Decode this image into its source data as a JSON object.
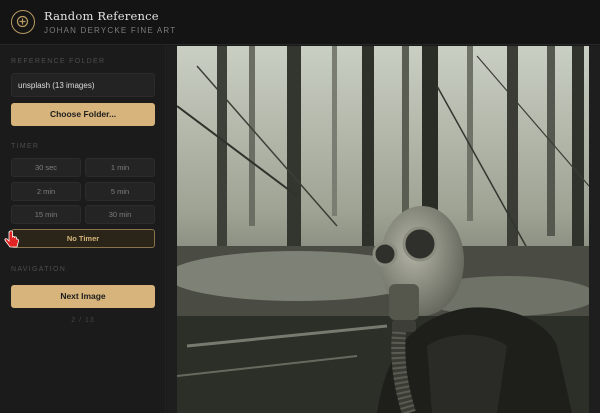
{
  "header": {
    "title": "Random Reference",
    "subtitle": "JOHAN DERYCKE FINE ART",
    "logo_icon": "plus-circle-icon"
  },
  "sidebar": {
    "folder": {
      "label": "REFERENCE FOLDER",
      "value": "unsplash (13 images)",
      "button": "Choose Folder..."
    },
    "timer": {
      "label": "TIMER",
      "options": [
        "30 sec",
        "1 min",
        "2 min",
        "5 min",
        "15 min",
        "30 min"
      ],
      "no_timer": "No Timer",
      "selected": "No Timer"
    },
    "navigation": {
      "label": "NAVIGATION",
      "next_button": "Next Image",
      "counter": "2 / 13"
    }
  },
  "viewer": {
    "image_icon": "reference-photo"
  },
  "colors": {
    "accent": "#d6b47b",
    "background": "#1a1a1a",
    "header": "#141414"
  }
}
